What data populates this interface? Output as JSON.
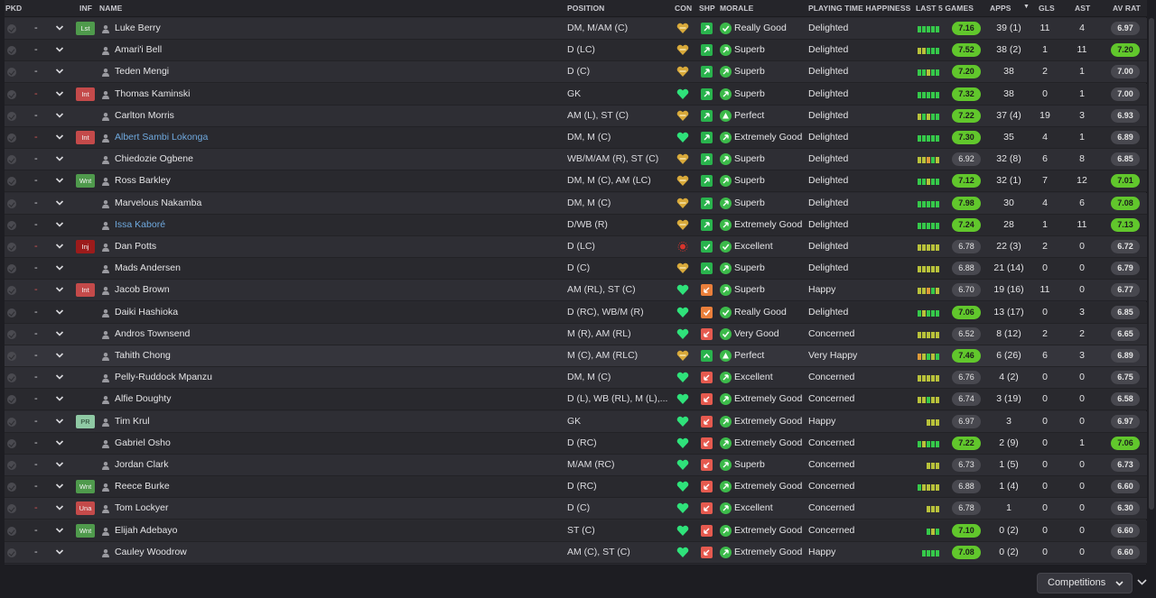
{
  "headers": {
    "pkd": "PKD",
    "inf": "INF",
    "name": "NAME",
    "position": "POSITION",
    "con": "CON",
    "shp": "SHP",
    "morale": "MORALE",
    "pth": "PLAYING TIME HAPPINESS",
    "last5": "LAST 5 GAMES",
    "apps": "APPS",
    "gls": "GLS",
    "ast": "AST",
    "avrat": "AV RAT"
  },
  "icons": {
    "sort": "sort-desc-icon",
    "picked": "check-circle-icon",
    "expand": "chevron-down-icon",
    "player": "person-icon",
    "condition": "heart-icon",
    "sharpness": "sharpness-arrow-icon",
    "morale": "morale-arrow-icon"
  },
  "colors": {
    "rating_high": "#61c72c",
    "rating_normal": "#48484f",
    "form_good": "#35c94a",
    "form_ok": "#b9c23a",
    "form_poor": "#e09a38",
    "condition_full": "#2fe27a",
    "condition_gold": "#d8a93a",
    "injury": "#d8342c",
    "link": "#6fa9de"
  },
  "players": [
    {
      "name": "Luke Berry",
      "inf": "Lst",
      "pos": "DM, M/AM (C)",
      "morale": "Really Good",
      "pth": "Delighted",
      "l5": "7.16",
      "apps": "39 (1)",
      "gls": "11",
      "ast": "4",
      "avr": "6.97"
    },
    {
      "name": "Amari'i Bell",
      "inf": "",
      "pos": "D (LC)",
      "morale": "Superb",
      "pth": "Delighted",
      "l5": "7.52",
      "apps": "38 (2)",
      "gls": "1",
      "ast": "11",
      "avr": "7.20"
    },
    {
      "name": "Teden Mengi",
      "inf": "",
      "pos": "D (C)",
      "morale": "Superb",
      "pth": "Delighted",
      "l5": "7.20",
      "apps": "38",
      "gls": "2",
      "ast": "1",
      "avr": "7.00"
    },
    {
      "name": "Thomas Kaminski",
      "inf": "Int",
      "pos": "GK",
      "morale": "Superb",
      "pth": "Delighted",
      "l5": "7.32",
      "apps": "38",
      "gls": "0",
      "ast": "1",
      "avr": "7.00"
    },
    {
      "name": "Carlton Morris",
      "inf": "",
      "pos": "AM (L), ST (C)",
      "morale": "Perfect",
      "pth": "Delighted",
      "l5": "7.22",
      "apps": "37 (4)",
      "gls": "19",
      "ast": "3",
      "avr": "6.93"
    },
    {
      "name": "Albert Sambi Lokonga",
      "inf": "Int",
      "pos": "DM, M (C)",
      "morale": "Extremely Good",
      "pth": "Delighted",
      "l5": "7.30",
      "apps": "35",
      "gls": "4",
      "ast": "1",
      "avr": "6.89"
    },
    {
      "name": "Chiedozie Ogbene",
      "inf": "",
      "pos": "WB/M/AM (R), ST (C)",
      "morale": "Superb",
      "pth": "Delighted",
      "l5": "6.92",
      "apps": "32 (8)",
      "gls": "6",
      "ast": "8",
      "avr": "6.85"
    },
    {
      "name": "Ross Barkley",
      "inf": "Wnt",
      "pos": "DM, M (C), AM (LC)",
      "morale": "Superb",
      "pth": "Delighted",
      "l5": "7.12",
      "apps": "32 (1)",
      "gls": "7",
      "ast": "12",
      "avr": "7.01"
    },
    {
      "name": "Marvelous Nakamba",
      "inf": "",
      "pos": "DM, M (C)",
      "morale": "Superb",
      "pth": "Delighted",
      "l5": "7.98",
      "apps": "30",
      "gls": "4",
      "ast": "6",
      "avr": "7.08"
    },
    {
      "name": "Issa Kaboré",
      "inf": "",
      "pos": "D/WB (R)",
      "morale": "Extremely Good",
      "pth": "Delighted",
      "l5": "7.24",
      "apps": "28",
      "gls": "1",
      "ast": "11",
      "avr": "7.13"
    },
    {
      "name": "Dan Potts",
      "inf": "Inj",
      "pos": "D (LC)",
      "morale": "Excellent",
      "pth": "Delighted",
      "l5": "6.78",
      "apps": "22 (3)",
      "gls": "2",
      "ast": "0",
      "avr": "6.72"
    },
    {
      "name": "Mads Andersen",
      "inf": "",
      "pos": "D (C)",
      "morale": "Superb",
      "pth": "Delighted",
      "l5": "6.88",
      "apps": "21 (14)",
      "gls": "0",
      "ast": "0",
      "avr": "6.79"
    },
    {
      "name": "Jacob Brown",
      "inf": "Int",
      "pos": "AM (RL), ST (C)",
      "morale": "Superb",
      "pth": "Happy",
      "l5": "6.70",
      "apps": "19 (16)",
      "gls": "11",
      "ast": "0",
      "avr": "6.77"
    },
    {
      "name": "Daiki Hashioka",
      "inf": "",
      "pos": "D (RC), WB/M (R)",
      "morale": "Really Good",
      "pth": "Delighted",
      "l5": "7.06",
      "apps": "13 (17)",
      "gls": "0",
      "ast": "3",
      "avr": "6.85"
    },
    {
      "name": "Andros Townsend",
      "inf": "",
      "pos": "M (R), AM (RL)",
      "morale": "Very Good",
      "pth": "Concerned",
      "l5": "6.52",
      "apps": "8 (12)",
      "gls": "2",
      "ast": "2",
      "avr": "6.65"
    },
    {
      "name": "Tahith Chong",
      "inf": "",
      "pos": "M (C), AM (RLC)",
      "morale": "Perfect",
      "pth": "Very Happy",
      "l5": "7.46",
      "apps": "6 (26)",
      "gls": "6",
      "ast": "3",
      "avr": "6.89"
    },
    {
      "name": "Pelly-Ruddock Mpanzu",
      "inf": "",
      "pos": "DM, M (C)",
      "morale": "Excellent",
      "pth": "Concerned",
      "l5": "6.76",
      "apps": "4 (2)",
      "gls": "0",
      "ast": "0",
      "avr": "6.75"
    },
    {
      "name": "Alfie Doughty",
      "inf": "",
      "pos": "D (L), WB (RL), M (L),...",
      "morale": "Extremely Good",
      "pth": "Concerned",
      "l5": "6.74",
      "apps": "3 (19)",
      "gls": "0",
      "ast": "0",
      "avr": "6.58"
    },
    {
      "name": "Tim Krul",
      "inf": "PR",
      "pos": "GK",
      "morale": "Extremely Good",
      "pth": "Happy",
      "l5": "6.97",
      "apps": "3",
      "gls": "0",
      "ast": "0",
      "avr": "6.97"
    },
    {
      "name": "Gabriel Osho",
      "inf": "",
      "pos": "D (RC)",
      "morale": "Extremely Good",
      "pth": "Concerned",
      "l5": "7.22",
      "apps": "2 (9)",
      "gls": "0",
      "ast": "1",
      "avr": "7.06"
    },
    {
      "name": "Jordan Clark",
      "inf": "",
      "pos": "M/AM (RC)",
      "morale": "Superb",
      "pth": "Concerned",
      "l5": "6.73",
      "apps": "1 (5)",
      "gls": "0",
      "ast": "0",
      "avr": "6.73"
    },
    {
      "name": "Reece Burke",
      "inf": "Wnt",
      "pos": "D (RC)",
      "morale": "Extremely Good",
      "pth": "Concerned",
      "l5": "6.88",
      "apps": "1 (4)",
      "gls": "0",
      "ast": "0",
      "avr": "6.60"
    },
    {
      "name": "Tom Lockyer",
      "inf": "Una",
      "pos": "D (C)",
      "morale": "Excellent",
      "pth": "Concerned",
      "l5": "6.78",
      "apps": "1",
      "gls": "0",
      "ast": "0",
      "avr": "6.30"
    },
    {
      "name": "Elijah Adebayo",
      "inf": "Wnt",
      "pos": "ST (C)",
      "morale": "Extremely Good",
      "pth": "Concerned",
      "l5": "7.10",
      "apps": "0 (2)",
      "gls": "0",
      "ast": "0",
      "avr": "6.60"
    },
    {
      "name": "Cauley Woodrow",
      "inf": "",
      "pos": "AM (C), ST (C)",
      "morale": "Extremely Good",
      "pth": "Happy",
      "l5": "7.08",
      "apps": "0 (2)",
      "gls": "0",
      "ast": "0",
      "avr": "6.60"
    }
  ],
  "competitions_label": "Competitions"
}
